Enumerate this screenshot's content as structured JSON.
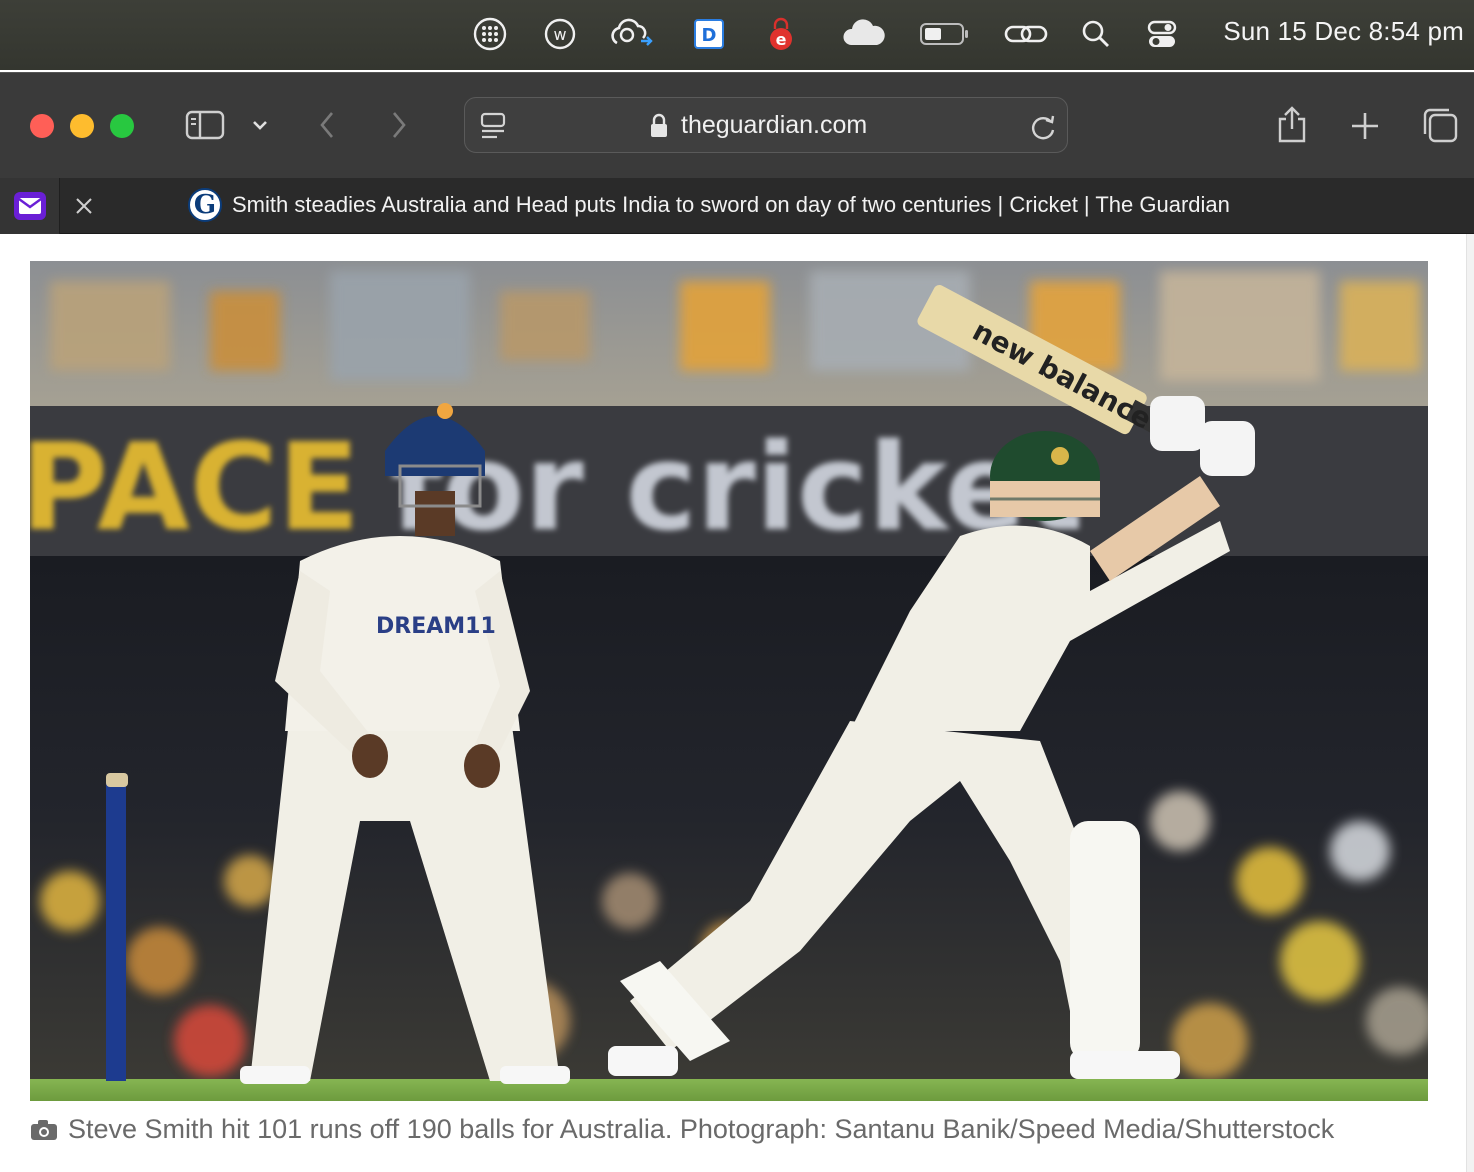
{
  "menubar": {
    "icons": [
      "grid-icon",
      "w-circle-icon",
      "cloud-sync-icon",
      "d-app-icon",
      "e-app-icon",
      "cloud-icon",
      "battery-icon",
      "link-icon",
      "search-icon",
      "control-center-icon"
    ],
    "clock": "Sun 15 Dec  8:54 pm"
  },
  "browser": {
    "url_domain": "theguardian.com",
    "tab_title": "Smith steadies Australia and Head puts India to sword on day of two centuries | Cricket | The Guardian",
    "favicon_letter": "G"
  },
  "article": {
    "photo": {
      "banner_text_left": "PACE",
      "banner_text_right": "for cricket",
      "fielder_shirt_text": "DREAM11",
      "bat_text": "new balance",
      "colors": {
        "fielder_cap": "#1c3a73",
        "batter_helmet": "#1f4b2e",
        "kit": "#f1efe6",
        "grass": "#7fae4a",
        "banner": "#3a3b40",
        "banner_yellow": "#d9b233"
      }
    },
    "caption": "Steve Smith hit 101 runs off 190 balls for Australia. Photograph: Santanu Banik/Speed Media/Shutterstock"
  }
}
